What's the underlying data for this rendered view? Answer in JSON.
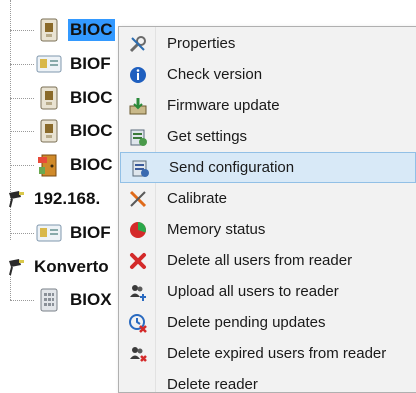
{
  "tree": {
    "nodes": [
      {
        "label": "BIOC",
        "selected": true,
        "icon": "reader-device-icon"
      },
      {
        "label": "BIOF",
        "selected": false,
        "icon": "card-reader-icon"
      },
      {
        "label": "BIOC",
        "selected": false,
        "icon": "reader-device-icon"
      },
      {
        "label": "BIOC",
        "selected": false,
        "icon": "reader-device-icon"
      },
      {
        "label": "BIOC",
        "selected": false,
        "icon": "door-controller-icon"
      },
      {
        "label": "192.168.",
        "selected": false,
        "icon": "network-host-icon"
      },
      {
        "label": "BIOF",
        "selected": false,
        "icon": "card-reader-icon"
      },
      {
        "label": "Konverto",
        "selected": false,
        "icon": "converter-host-icon"
      },
      {
        "label": "BIOX",
        "selected": false,
        "icon": "keypad-reader-icon"
      }
    ]
  },
  "menu": {
    "items": [
      {
        "label": "Properties",
        "icon": "wrench-tools-icon"
      },
      {
        "label": "Check version",
        "icon": "info-icon"
      },
      {
        "label": "Firmware update",
        "icon": "firmware-install-icon"
      },
      {
        "label": "Get settings",
        "icon": "get-settings-icon"
      },
      {
        "label": "Send configuration",
        "icon": "send-configuration-icon",
        "highlighted": true
      },
      {
        "label": "Calibrate",
        "icon": "calibrate-icon"
      },
      {
        "label": "Memory status",
        "icon": "pie-chart-icon"
      },
      {
        "label": "Delete all users from reader",
        "icon": "red-x-icon"
      },
      {
        "label": "Upload all users to reader",
        "icon": "users-upload-icon"
      },
      {
        "label": "Delete pending updates",
        "icon": "delete-pending-icon"
      },
      {
        "label": "Delete expired users from reader",
        "icon": "delete-expired-users-icon"
      },
      {
        "label": "Delete reader",
        "icon": "delete-reader-icon"
      }
    ]
  },
  "colors": {
    "selection": "#3399ff",
    "menu_background": "#f2f2f2",
    "highlight": "#d8e9f7"
  }
}
